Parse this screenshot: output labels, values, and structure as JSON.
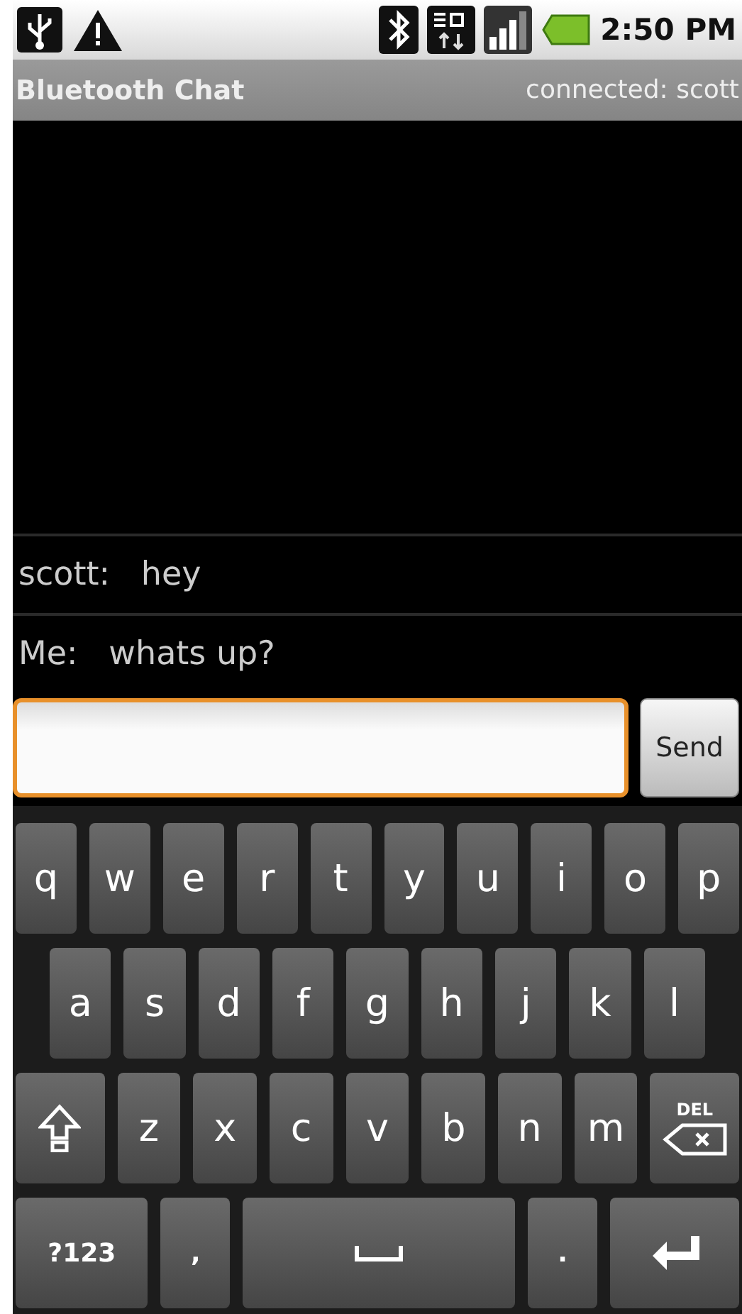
{
  "status_bar": {
    "time": "2:50 PM"
  },
  "title_bar": {
    "title": "Bluetooth Chat",
    "status": "connected: scott"
  },
  "messages": [
    {
      "sender": "scott:",
      "text": "hey"
    },
    {
      "sender": "Me:",
      "text": "whats up?"
    }
  ],
  "compose": {
    "send_button": "Send"
  },
  "keyboard": [
    [
      {
        "kind": "letter",
        "label": "q"
      },
      {
        "kind": "letter",
        "label": "w"
      },
      {
        "kind": "letter",
        "label": "e"
      },
      {
        "kind": "letter",
        "label": "r"
      },
      {
        "kind": "letter",
        "label": "t"
      },
      {
        "kind": "letter",
        "label": "y"
      },
      {
        "kind": "letter",
        "label": "u"
      },
      {
        "kind": "letter",
        "label": "i"
      },
      {
        "kind": "letter",
        "label": "o"
      },
      {
        "kind": "letter",
        "label": "p"
      }
    ],
    [
      {
        "kind": "letter",
        "label": "a"
      },
      {
        "kind": "letter",
        "label": "s"
      },
      {
        "kind": "letter",
        "label": "d"
      },
      {
        "kind": "letter",
        "label": "f"
      },
      {
        "kind": "letter",
        "label": "g"
      },
      {
        "kind": "letter",
        "label": "h"
      },
      {
        "kind": "letter",
        "label": "j"
      },
      {
        "kind": "letter",
        "label": "k"
      },
      {
        "kind": "letter",
        "label": "l"
      }
    ],
    [
      {
        "kind": "shift"
      },
      {
        "kind": "letter",
        "label": "z"
      },
      {
        "kind": "letter",
        "label": "x"
      },
      {
        "kind": "letter",
        "label": "c"
      },
      {
        "kind": "letter",
        "label": "v"
      },
      {
        "kind": "letter",
        "label": "b"
      },
      {
        "kind": "letter",
        "label": "n"
      },
      {
        "kind": "letter",
        "label": "m"
      },
      {
        "kind": "delete",
        "label": "DEL"
      }
    ],
    [
      {
        "kind": "symbols",
        "label": "?123"
      },
      {
        "kind": "punct",
        "label": ","
      },
      {
        "kind": "space"
      },
      {
        "kind": "punct",
        "label": "."
      },
      {
        "kind": "enter"
      }
    ]
  ]
}
